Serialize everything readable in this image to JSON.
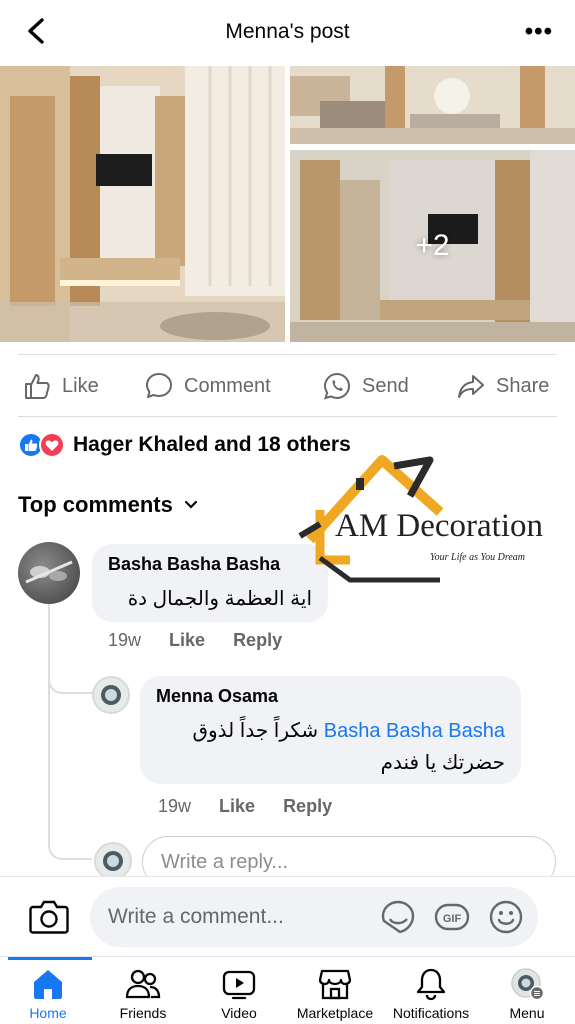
{
  "header": {
    "title": "Menna's post"
  },
  "photos": {
    "more_count": "+2"
  },
  "actions": {
    "like": "Like",
    "comment": "Comment",
    "send": "Send",
    "share": "Share"
  },
  "reactions": {
    "text": "Hager Khaled and 18 others"
  },
  "top_comments_label": "Top comments",
  "comments": [
    {
      "author": "Basha Basha Basha",
      "text": "اية العظمة والجمال دة",
      "time": "19w",
      "like": "Like",
      "reply": "Reply"
    }
  ],
  "replies": [
    {
      "author": "Menna Osama",
      "mention": "Basha Basha Basha",
      "text_line1": "شكراً جداً لذوق",
      "text_line2": "حضرتك يا فندم",
      "time": "19w",
      "like": "Like",
      "reply": "Reply"
    }
  ],
  "reply_input_placeholder": "Write a reply...",
  "watermark": {
    "brand": "AM Decoration",
    "tagline": "Your Life as You Dream"
  },
  "composer": {
    "placeholder": "Write a comment...",
    "gif": "GIF"
  },
  "nav": [
    {
      "label": "Home",
      "icon": "home-icon",
      "active": true
    },
    {
      "label": "Friends",
      "icon": "friends-icon"
    },
    {
      "label": "Video",
      "icon": "video-icon"
    },
    {
      "label": "Marketplace",
      "icon": "marketplace-icon"
    },
    {
      "label": "Notifications",
      "icon": "bell-icon"
    },
    {
      "label": "Menu",
      "icon": "menu-avatar-icon"
    }
  ],
  "colors": {
    "accent": "#1877f2",
    "love": "#f33e58",
    "muted": "#65676b",
    "bubble": "#f0f2f5"
  }
}
